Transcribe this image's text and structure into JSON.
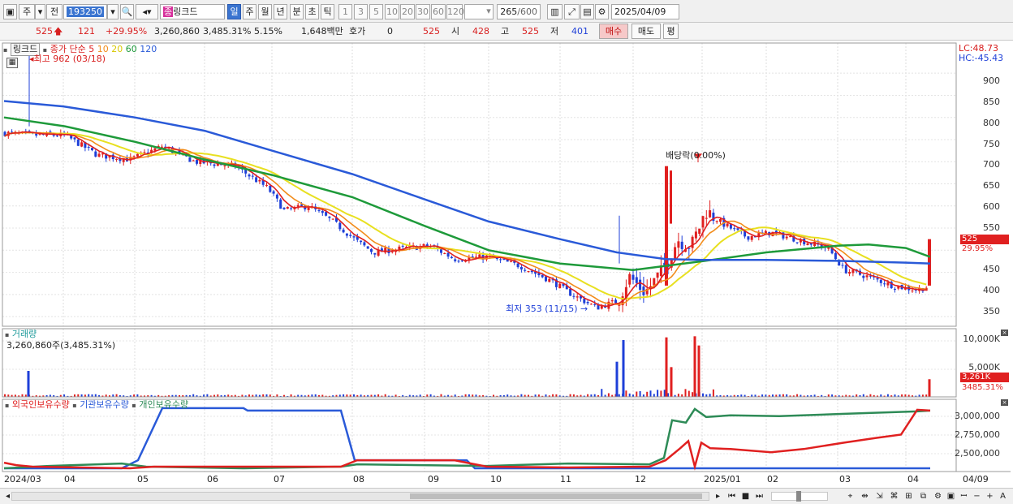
{
  "toolbar": {
    "period_jong": "주",
    "period_jeon": "전",
    "code": "193250",
    "stock_name": "링크드",
    "stock_badge": "종",
    "periods": [
      "일",
      "주",
      "월",
      "년",
      "분",
      "초",
      "틱"
    ],
    "active_period": "일",
    "intervals": [
      "1",
      "3",
      "5",
      "10",
      "20",
      "30",
      "60",
      "120"
    ],
    "count": "265",
    "count_total": "/600",
    "date": "2025/04/09"
  },
  "quote": {
    "price": "525",
    "change": "121",
    "change_pct": "+29.95%",
    "volume": "3,260,860",
    "volume_pct": "3,485.31%",
    "turnover_pct": "5.15%",
    "amount": "1,648백만",
    "hoga_label": "호가",
    "hoga_value": "0",
    "hoga_price": "525",
    "open_label": "시",
    "open": "428",
    "high_label": "고",
    "high": "525",
    "low_label": "저",
    "low": "401",
    "buy_label": "매수",
    "sell_label": "매도",
    "eval_label": "평"
  },
  "price_panel": {
    "name_tag": "링크드",
    "legend_prefix": "종가 단순",
    "ma_labels": [
      "5",
      "10",
      "20",
      "60",
      "120"
    ],
    "ma_colors": [
      "#e02020",
      "#f28c1a",
      "#e8e020",
      "#1e9a3a",
      "#2a5ad8"
    ],
    "high_note": "최고 962 (03/18)",
    "low_note": "최저 353 (11/15)",
    "dividend_note": "배당락(0.00%)",
    "lc": "LC:48.73",
    "hc": "HC:-45.43",
    "y_ticks": [
      "900",
      "850",
      "800",
      "750",
      "700",
      "650",
      "600",
      "550",
      "500",
      "450",
      "400",
      "350"
    ],
    "last_price_tag": "525",
    "last_pct_tag": "29.95%"
  },
  "volume_panel": {
    "title": "거래량",
    "value": "3,260,860주(3,485.31%)",
    "y_ticks": [
      "10,000K",
      "5,000K"
    ],
    "last_tag": "3,261K",
    "last_pct": "3485.31%"
  },
  "holder_panel": {
    "series": [
      "외국인보유수량",
      "기관보유수량",
      "개인보유수량"
    ],
    "colors": [
      "#e02020",
      "#2a5ad8",
      "#2e8b57"
    ],
    "y_ticks": [
      "3,000,000",
      "2,750,000",
      "2,500,000"
    ]
  },
  "x_axis": [
    "2024/03",
    "04",
    "05",
    "06",
    "07",
    "08",
    "09",
    "10",
    "11",
    "12",
    "2025/01",
    "02",
    "03",
    "04",
    "04/09"
  ],
  "chart_data": [
    {
      "type": "line",
      "title": "링크드",
      "x": [
        "2024/03",
        "2024/04",
        "2024/05",
        "2024/06",
        "2024/07",
        "2024/08",
        "2024/09",
        "2024/10",
        "2024/11",
        "2024/12",
        "2025/01",
        "2025/02",
        "2025/03",
        "2025/04"
      ],
      "series": [
        {
          "name": "종가",
          "values": [
            765,
            745,
            720,
            680,
            600,
            500,
            510,
            470,
            430,
            420,
            560,
            520,
            460,
            525
          ]
        },
        {
          "name": "120",
          "values": [
            835,
            820,
            795,
            765,
            715,
            665,
            605,
            560,
            500,
            480,
            480,
            478,
            475,
            470
          ]
        },
        {
          "name": "60",
          "values": [
            790,
            770,
            745,
            705,
            670,
            610,
            540,
            490,
            450,
            450,
            500,
            505,
            500,
            490
          ]
        }
      ],
      "annotations": [
        "최고 962 (03/18)",
        "최저 353 (11/15)",
        "배당락(0.00%)"
      ],
      "ylim": [
        330,
        970
      ]
    },
    {
      "type": "bar",
      "title": "거래량",
      "x": [
        "2024/03",
        "2024/11",
        "2024/12",
        "2025/01",
        "2025/04/09"
      ],
      "values": [
        4800,
        9500,
        11000,
        11200,
        3261
      ],
      "ylabel": "K",
      "ylim": [
        0,
        12000
      ]
    },
    {
      "type": "line",
      "series": [
        {
          "name": "외국인보유수량",
          "values": [
            2470,
            2400,
            2410,
            2410,
            2410,
            2400,
            2410,
            2400,
            2400,
            2400,
            2720,
            2650,
            2800,
            3120
          ]
        },
        {
          "name": "기관보유수량",
          "values": [
            2400,
            2400,
            3150,
            3150,
            3150,
            2500,
            2500,
            2400,
            2400,
            2400,
            2400,
            2400,
            2400,
            2400
          ]
        },
        {
          "name": "개인보유수량",
          "values": [
            2440,
            2420,
            2400,
            2420,
            2400,
            2420,
            2420,
            2440,
            2440,
            2460,
            3040,
            3060,
            3080,
            3100
          ]
        }
      ],
      "ylim": [
        2380,
        3200
      ]
    }
  ]
}
